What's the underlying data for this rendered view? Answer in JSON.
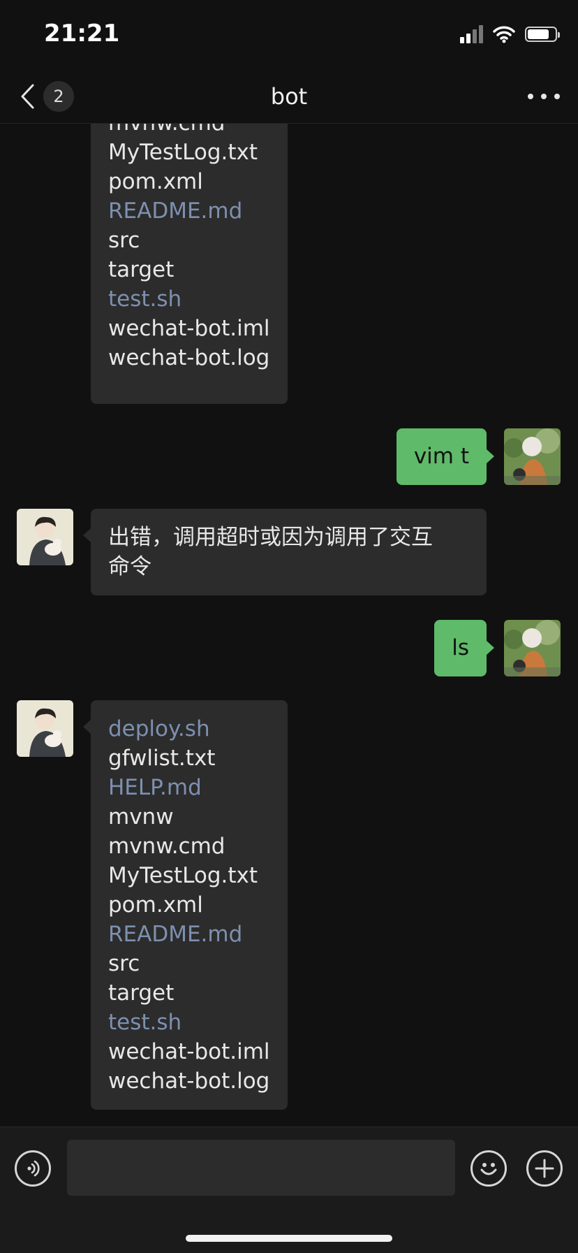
{
  "status_bar": {
    "time": "21:21"
  },
  "header": {
    "unread_count": "2",
    "title": "bot"
  },
  "messages": [
    {
      "from": "bot",
      "lines": [
        {
          "text": "mvnw.cmd",
          "link": false
        },
        {
          "text": "MyTestLog.txt",
          "link": false
        },
        {
          "text": "pom.xml",
          "link": false
        },
        {
          "text": "README.md",
          "link": true
        },
        {
          "text": "src",
          "link": false
        },
        {
          "text": "target",
          "link": false
        },
        {
          "text": "test.sh",
          "link": true
        },
        {
          "text": "wechat-bot.iml",
          "link": false
        },
        {
          "text": "wechat-bot.log",
          "link": false
        }
      ]
    },
    {
      "from": "me",
      "text": "vim t"
    },
    {
      "from": "bot",
      "lines": [
        {
          "text": "出错，调用超时或因为调用了交互",
          "link": false
        },
        {
          "text": "命令",
          "link": false
        }
      ]
    },
    {
      "from": "me",
      "text": "ls"
    },
    {
      "from": "bot",
      "lines": [
        {
          "text": "deploy.sh",
          "link": true
        },
        {
          "text": "gfwlist.txt",
          "link": false
        },
        {
          "text": "HELP.md",
          "link": true
        },
        {
          "text": "mvnw",
          "link": false
        },
        {
          "text": "mvnw.cmd",
          "link": false
        },
        {
          "text": "MyTestLog.txt",
          "link": false
        },
        {
          "text": "pom.xml",
          "link": false
        },
        {
          "text": "README.md",
          "link": true
        },
        {
          "text": "src",
          "link": false
        },
        {
          "text": "target",
          "link": false
        },
        {
          "text": "test.sh",
          "link": true
        },
        {
          "text": "wechat-bot.iml",
          "link": false
        },
        {
          "text": "wechat-bot.log",
          "link": false
        }
      ]
    }
  ],
  "input": {
    "value": "",
    "placeholder": ""
  },
  "colors": {
    "background": "#111111",
    "incoming_bubble": "#2c2c2c",
    "outgoing_bubble": "#5fba6a",
    "link_text": "#7d90b0"
  },
  "icons": {
    "back": "chevron-left-icon",
    "more": "more-icon",
    "voice": "voice-icon",
    "emoji": "emoji-icon",
    "add": "plus-icon"
  }
}
